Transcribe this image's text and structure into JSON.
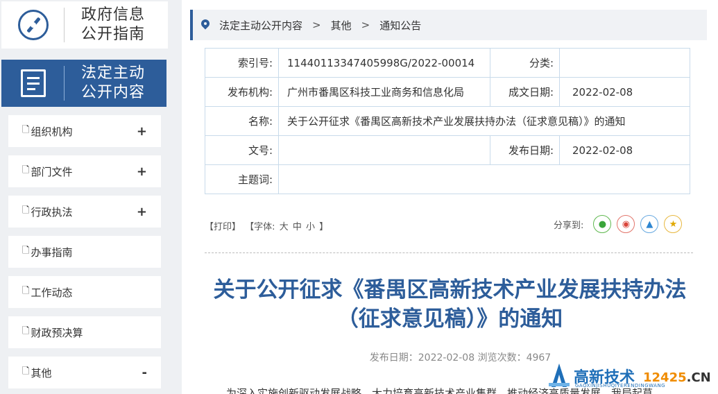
{
  "sidebar": {
    "guide_title_1": "政府信息",
    "guide_title_2": "公开指南",
    "active_title_1": "法定主动",
    "active_title_2": "公开内容",
    "items": [
      {
        "label": "组织机构",
        "toggle": "+"
      },
      {
        "label": "部门文件",
        "toggle": "+"
      },
      {
        "label": "行政执法",
        "toggle": "+"
      },
      {
        "label": "办事指南",
        "toggle": ""
      },
      {
        "label": "工作动态",
        "toggle": ""
      },
      {
        "label": "财政预决算",
        "toggle": ""
      },
      {
        "label": "其他",
        "toggle": "-"
      }
    ]
  },
  "breadcrumb": {
    "item1": "法定主动公开内容",
    "item2": "其他",
    "item3": "通知公告",
    "sep": ">"
  },
  "meta": {
    "index_label": "索引号:",
    "index_value": "11440113347405998G/2022-00014",
    "category_label": "分类:",
    "category_value": "",
    "org_label": "发布机构:",
    "org_value": "广州市番禺区科技工业商务和信息化局",
    "created_label": "成文日期:",
    "created_value": "2022-02-08",
    "name_label": "名称:",
    "name_value": "关于公开征求《番禺区高新技术产业发展扶持办法（征求意见稿）》的通知",
    "docno_label": "文号:",
    "docno_value": "",
    "published_label": "发布日期:",
    "published_value": "2022-02-08",
    "subject_label": "主题词:",
    "subject_value": ""
  },
  "tools": {
    "print": "【打印】",
    "font_prefix": "【字体:",
    "large": "大",
    "medium": "中",
    "small": "小",
    "font_suffix": "】",
    "share_label": "分享到:"
  },
  "article": {
    "title_line1": "关于公开征求《番禺区高新技术产业发展扶持办法",
    "title_line2": "（征求意见稿）》的通知",
    "pub_info": "发布日期：2022-02-08  浏览次数：4967",
    "body_start": "为深入实施创新驱动发展战略，大力培育高新技术产业集群，推动经济高质量发展，我局起草"
  },
  "watermark": {
    "text": "高新技术",
    "sub": "GAOXINJISHUQIYERENDINGWANG",
    "num_a": "12425",
    "num_b": ".CN"
  }
}
